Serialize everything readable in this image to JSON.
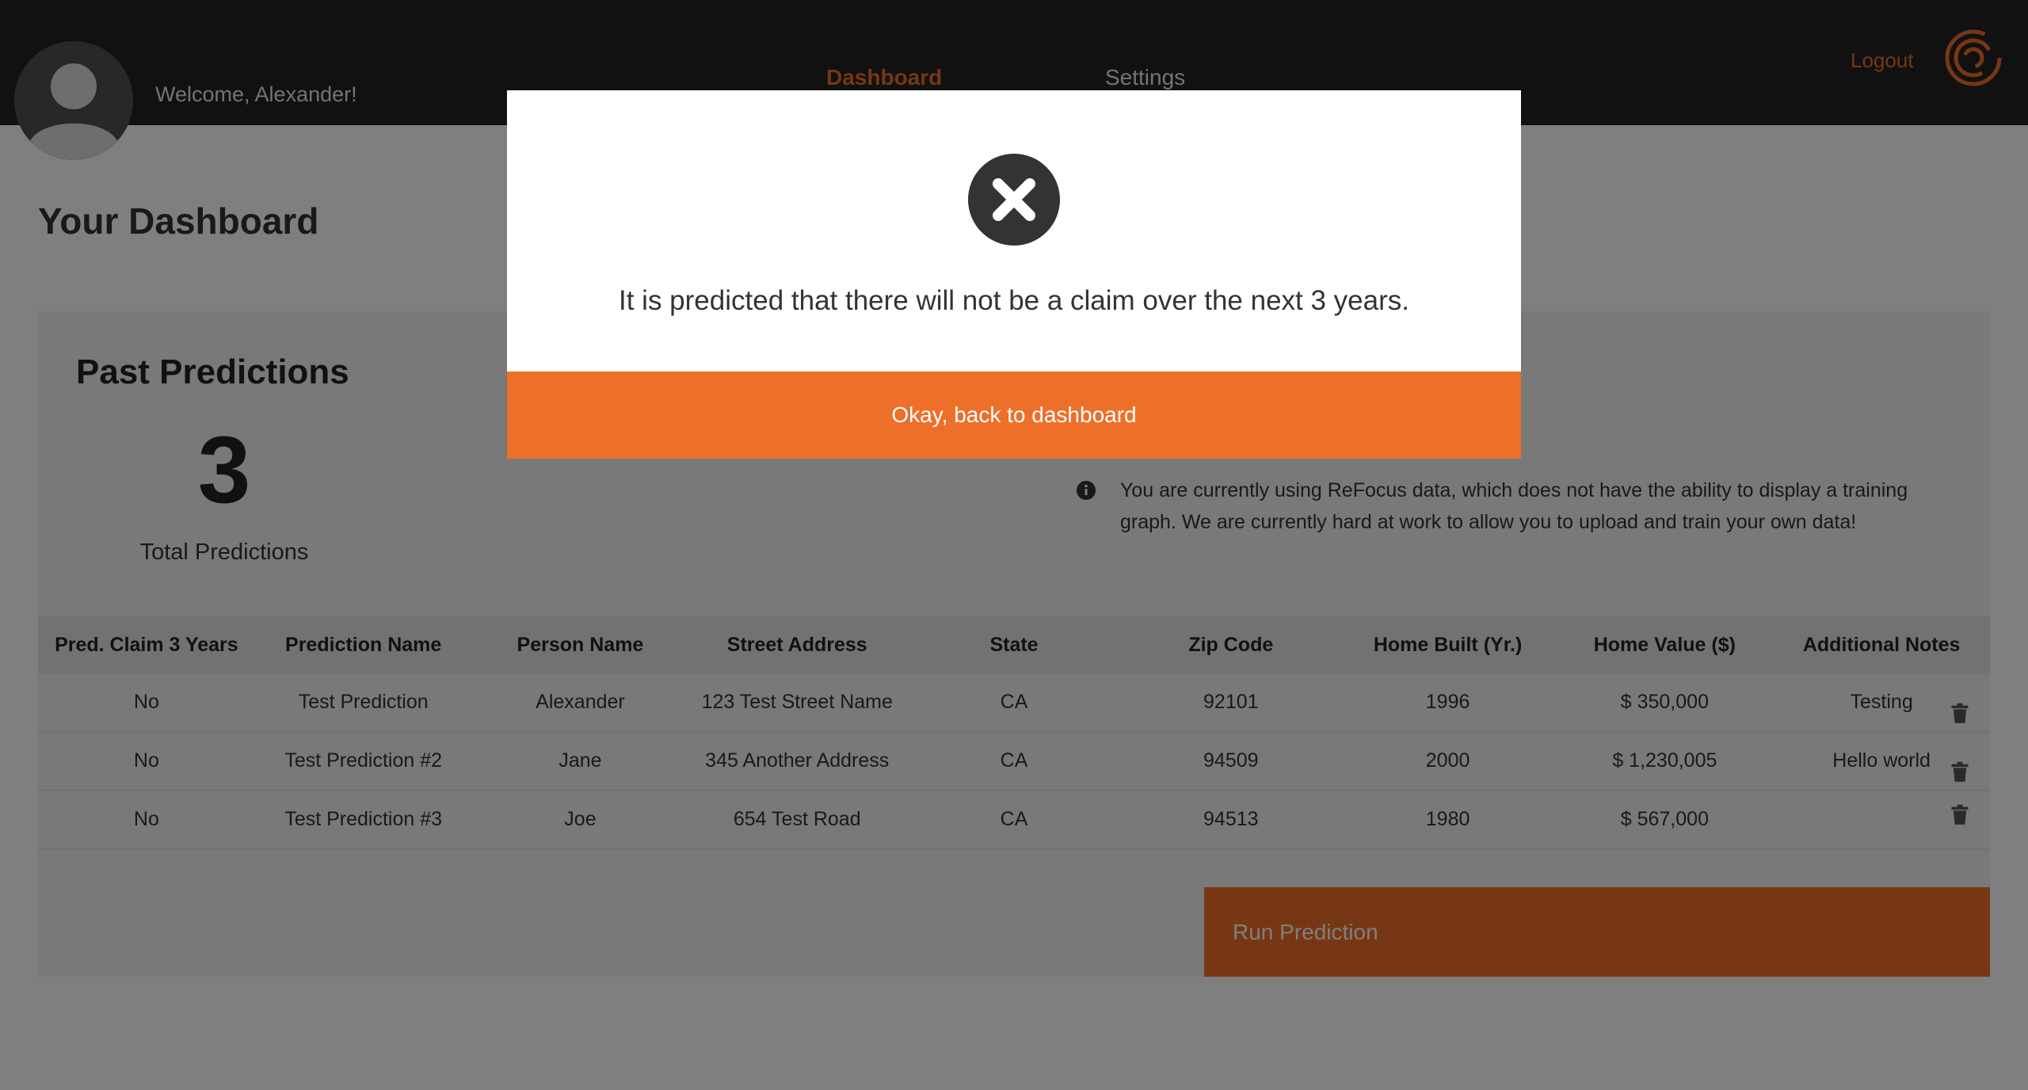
{
  "header": {
    "welcome": "Welcome, Alexander!",
    "nav": [
      {
        "label": "Dashboard",
        "active": true
      },
      {
        "label": "Settings",
        "active": false
      }
    ],
    "logout": "Logout"
  },
  "page": {
    "title": "Your Dashboard"
  },
  "past_predictions": {
    "title": "Past Predictions",
    "count": "3",
    "count_label": "Total Predictions",
    "info": "You are currently using ReFocus data, which does not have the ability to display a training graph. We are currently hard at work to allow you to upload and train your own data!"
  },
  "table": {
    "headers": [
      "Pred. Claim 3 Years",
      "Prediction Name",
      "Person Name",
      "Street Address",
      "State",
      "Zip Code",
      "Home Built (Yr.)",
      "Home Value ($)",
      "Additional Notes"
    ],
    "rows": [
      [
        "No",
        "Test Prediction",
        "Alexander",
        "123 Test Street Name",
        "CA",
        "92101",
        "1996",
        "$ 350,000",
        "Testing"
      ],
      [
        "No",
        "Test Prediction #2",
        "Jane",
        "345 Another Address",
        "CA",
        "94509",
        "2000",
        "$ 1,230,005",
        "Hello world"
      ],
      [
        "No",
        "Test Prediction #3",
        "Joe",
        "654 Test Road",
        "CA",
        "94513",
        "1980",
        "$ 567,000",
        ""
      ]
    ]
  },
  "run_button": "Run Prediction",
  "modal": {
    "message": "It is predicted that there will not be a claim over the next 3 years.",
    "button": "Okay, back to dashboard"
  },
  "colors": {
    "accent": "#ee6f29",
    "header_bg": "#222222",
    "overlay": "rgba(0,0,0,0.5)"
  },
  "icons": [
    "user-avatar-icon",
    "brand-logo-icon",
    "info-icon",
    "trash-icon",
    "close-circle-icon"
  ]
}
